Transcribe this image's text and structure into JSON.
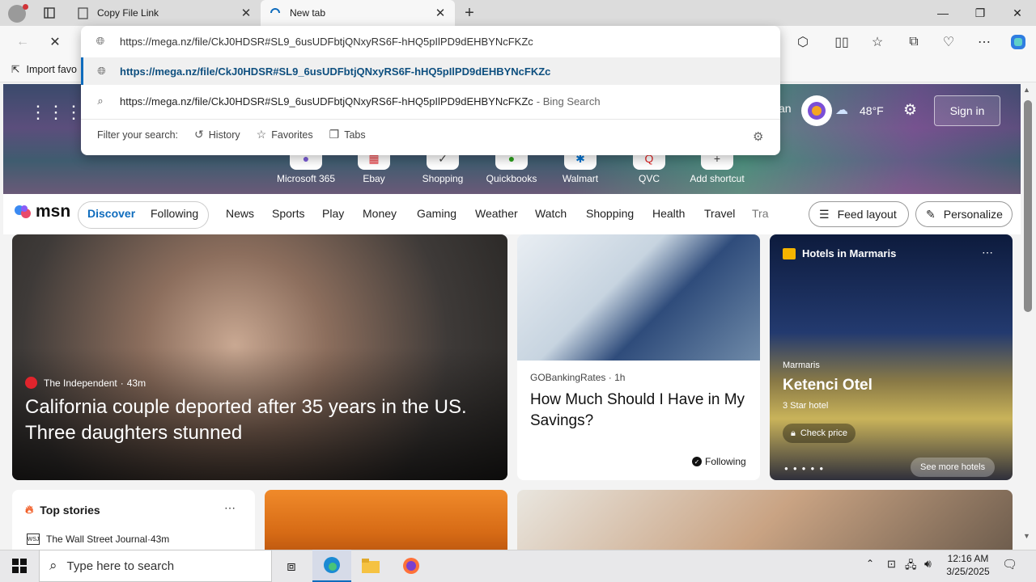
{
  "tabs": [
    {
      "title": "Copy File Link",
      "icon": "page-icon"
    },
    {
      "title": "New tab",
      "icon": "loading-icon"
    }
  ],
  "omnibox": {
    "input_value": "https://mega.nz/file/CkJ0HDSR#SL9_6usUDFbtjQNxyRS6F-hHQ5pIlPD9dEHBYNcFKZc",
    "suggestions": [
      {
        "text": "https://mega.nz/file/CkJ0HDSR#SL9_6usUDFbtjQNxyRS6F-hHQ5pIlPD9dEHBYNcFKZc",
        "suffix": ""
      },
      {
        "text": "https://mega.nz/file/CkJ0HDSR#SL9_6usUDFbtjQNxyRS6F-hHQ5pIlPD9dEHBYNcFKZc",
        "suffix": "- Bing Search"
      }
    ],
    "filter_label": "Filter your search:",
    "filters": [
      "History",
      "Favorites",
      "Tabs"
    ]
  },
  "favorites_bar": {
    "import_label": "Import favo"
  },
  "hero": {
    "user_fragment": "an",
    "weather_temp": "48°F",
    "sign_in": "Sign in",
    "shortcuts": [
      "Microsoft 365",
      "Ebay",
      "Shopping",
      "Quickbooks",
      "Walmart",
      "QVC",
      "Add shortcut"
    ]
  },
  "msn": {
    "logo": "msn",
    "discover": "Discover",
    "following": "Following",
    "nav": [
      "News",
      "Sports",
      "Play",
      "Money",
      "Gaming",
      "Weather",
      "Watch",
      "Shopping",
      "Health",
      "Travel",
      "Tra"
    ],
    "feed_layout": "Feed layout",
    "personalize": "Personalize"
  },
  "cards": {
    "main": {
      "source": "The Independent",
      "age": "43m",
      "headline": "California couple deported after 35 years in the US. Three daughters stunned"
    },
    "second": {
      "source": "GOBankingRates",
      "age": "1h",
      "headline": "How Much Should I Have in My Savings?",
      "following": "Following"
    },
    "hotel": {
      "header": "Hotels in Marmaris",
      "location": "Marmaris",
      "name": "Ketenci Otel",
      "stars": "3 Star hotel",
      "check_price": "Check price",
      "see_more": "See more hotels"
    },
    "top_stories": {
      "title": "Top stories",
      "item_source": "The Wall Street Journal",
      "item_age": "43m"
    }
  },
  "taskbar": {
    "search_placeholder": "Type here to search",
    "time": "12:16 AM",
    "date": "3/25/2025"
  },
  "colors": {
    "accent": "#0f6cbd",
    "tabbar": "#dcdcdc",
    "toolbar": "#f7f7f7"
  }
}
